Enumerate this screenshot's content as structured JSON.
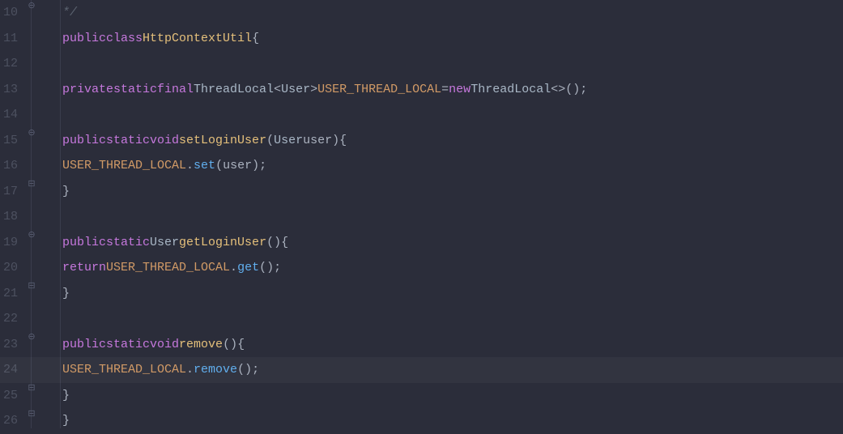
{
  "lineNumbers": [
    "10",
    "11",
    "12",
    "13",
    "14",
    "15",
    "16",
    "17",
    "18",
    "19",
    "20",
    "21",
    "22",
    "23",
    "24",
    "25",
    "26"
  ],
  "highlightedLine": 24,
  "foldMarkers": {
    "10": "minus",
    "15": "minus",
    "17": "end",
    "19": "minus",
    "21": "end",
    "23": "minus",
    "25": "end",
    "26": "end"
  },
  "code": {
    "l10": {
      "comment_end": "*/"
    },
    "l11": {
      "kw1": "public",
      "kw2": "class",
      "className": "HttpContextUtil",
      "brace": "{"
    },
    "l13": {
      "kw1": "private",
      "kw2": "static",
      "kw3": "final",
      "type1": "ThreadLocal",
      "lt": "<",
      "type2": "User",
      "gt": ">",
      "field": "USER_THREAD_LOCAL",
      "eq": "=",
      "kw4": "new",
      "type3": "ThreadLocal",
      "diamond": "<>()",
      "semi": ";"
    },
    "l15": {
      "kw1": "public",
      "kw2": "static",
      "kw3": "void",
      "method": "setLoginUser",
      "lp": "(",
      "ptype": "User",
      "pname": "user",
      "rp": ")",
      "brace": "{"
    },
    "l16": {
      "field": "USER_THREAD_LOCAL",
      "dot": ".",
      "method": "set",
      "lp": "(",
      "arg": "user",
      "rp": ")",
      "semi": ";"
    },
    "l17": {
      "brace": "}"
    },
    "l19": {
      "kw1": "public",
      "kw2": "static",
      "type": "User",
      "method": "getLoginUser",
      "parens": "()",
      "brace": "{"
    },
    "l20": {
      "kw": "return",
      "field": "USER_THREAD_LOCAL",
      "dot": ".",
      "method": "get",
      "parens": "()",
      "semi": ";"
    },
    "l21": {
      "brace": "}"
    },
    "l23": {
      "kw1": "public",
      "kw2": "static",
      "kw3": "void",
      "method": "remove",
      "parens": "()",
      "brace": "{"
    },
    "l24": {
      "field": "USER_THREAD_LOCAL",
      "dot": ".",
      "method": "remove",
      "parens": "()",
      "semi": ";"
    },
    "l25": {
      "brace": "}"
    },
    "l26": {
      "brace": "}"
    }
  }
}
